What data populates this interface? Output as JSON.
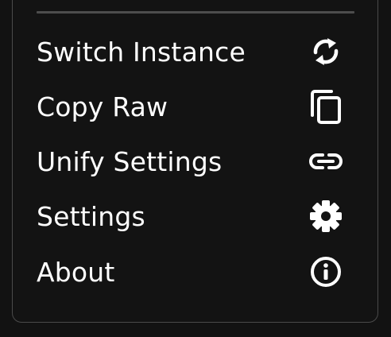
{
  "menu": {
    "items": [
      {
        "label": "Switch Instance",
        "icon": "refresh-icon"
      },
      {
        "label": "Copy Raw",
        "icon": "copy-icon"
      },
      {
        "label": "Unify Settings",
        "icon": "link-icon"
      },
      {
        "label": "Settings",
        "icon": "gear-icon"
      },
      {
        "label": "About",
        "icon": "info-icon"
      }
    ]
  },
  "colors": {
    "background": "#121212",
    "panel_border": "#4a4a4a",
    "text": "#ffffff",
    "divider": "#4d4d4d"
  }
}
